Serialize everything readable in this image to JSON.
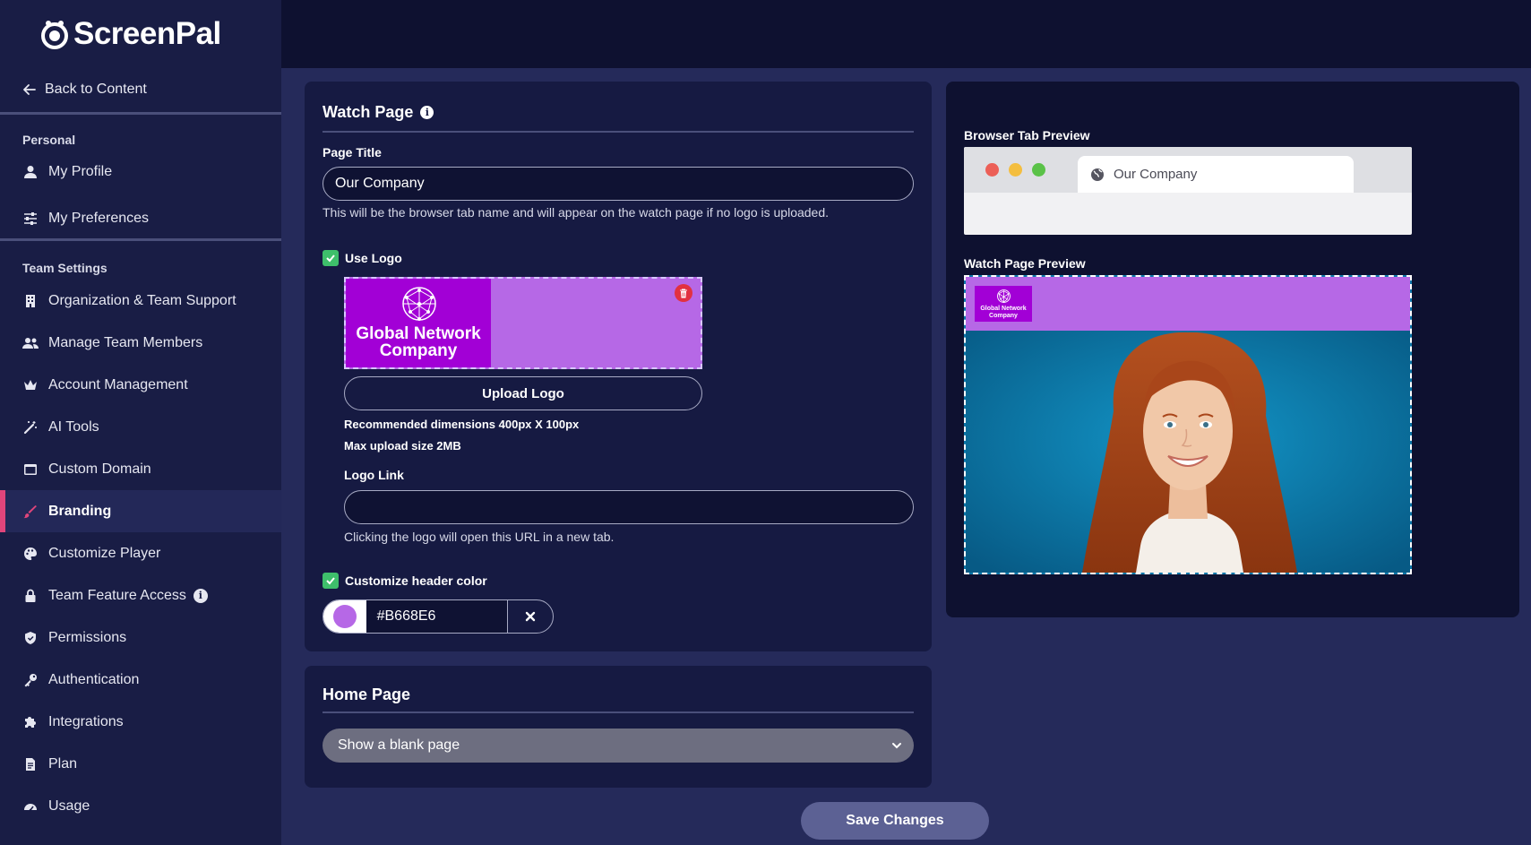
{
  "brand": {
    "name_part1": "Screen",
    "name_part2": "Pal"
  },
  "sidebar": {
    "back_label": "Back to Content",
    "personal_label": "Personal",
    "personal_items": [
      {
        "label": "My Profile",
        "icon": "user-icon"
      },
      {
        "label": "My Preferences",
        "icon": "sliders-icon"
      }
    ],
    "team_label": "Team Settings",
    "team_items": [
      {
        "label": "Organization & Team Support",
        "icon": "building-icon"
      },
      {
        "label": "Manage Team Members",
        "icon": "users-icon"
      },
      {
        "label": "Account Management",
        "icon": "crown-icon"
      },
      {
        "label": "AI Tools",
        "icon": "magic-wand-icon"
      },
      {
        "label": "Custom Domain",
        "icon": "window-icon"
      },
      {
        "label": "Branding",
        "icon": "brush-icon",
        "active": true
      },
      {
        "label": "Customize Player",
        "icon": "palette-icon"
      },
      {
        "label": "Team Feature Access",
        "icon": "lock-icon"
      },
      {
        "label": "Permissions",
        "icon": "shield-icon"
      },
      {
        "label": "Authentication",
        "icon": "key-icon"
      },
      {
        "label": "Integrations",
        "icon": "puzzle-icon"
      },
      {
        "label": "Plan",
        "icon": "document-icon"
      },
      {
        "label": "Usage",
        "icon": "gauge-icon"
      }
    ]
  },
  "watch_page": {
    "title": "Watch Page",
    "page_title_label": "Page Title",
    "page_title_value": "Our Company",
    "page_title_help": "This will be the browser tab name and will appear on the watch page if no logo is uploaded.",
    "use_logo_label": "Use Logo",
    "logo_company_line1": "Global Network",
    "logo_company_line2": "Company",
    "upload_logo_label": "Upload Logo",
    "recommended_dims": "Recommended dimensions 400px X 100px",
    "max_upload": "Max upload size 2MB",
    "logo_link_label": "Logo Link",
    "logo_link_value": "",
    "logo_link_help": "Clicking the logo will open this URL in a new tab.",
    "header_color_label": "Customize header color",
    "header_color_value": "#B668E6"
  },
  "home_page": {
    "title": "Home Page",
    "select_value": "Show a blank page"
  },
  "save_label": "Save Changes",
  "preview": {
    "browser_tab_label": "Browser Tab Preview",
    "browser_tab_title": "Our Company",
    "watch_page_label": "Watch Page Preview",
    "mini_logo_line1": "Global Network",
    "mini_logo_line2": "Company"
  },
  "colors": {
    "sidebar_bg": "#191d45",
    "main_bg": "#252a5a",
    "accent_active": "#e0457b",
    "check_green": "#3ebf6b",
    "header_color": "#b668e6",
    "logo_purple": "#a200d6"
  }
}
